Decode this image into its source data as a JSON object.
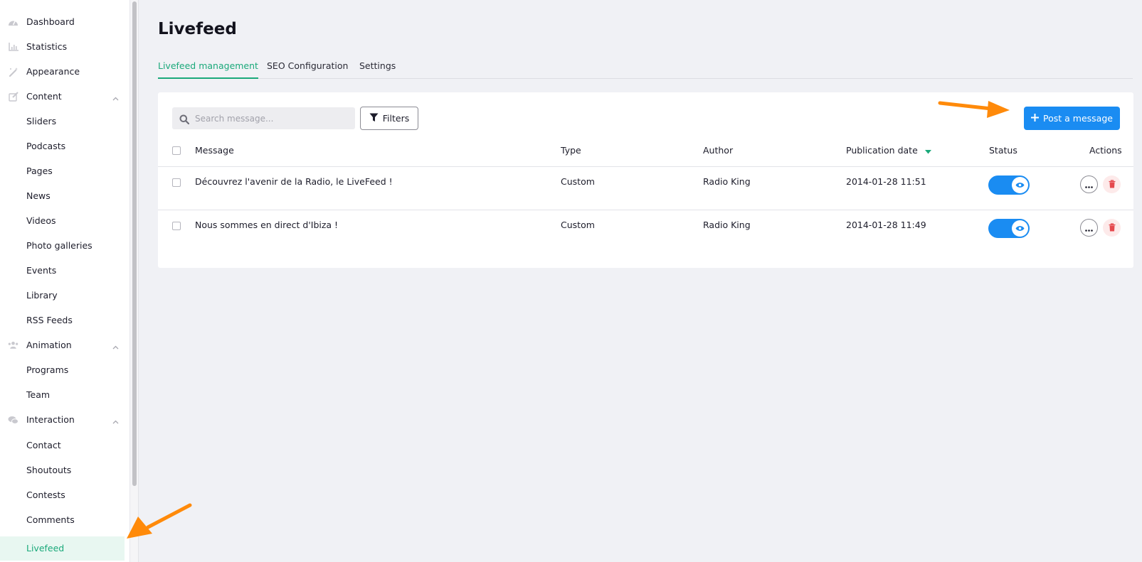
{
  "sidebar": {
    "items": [
      {
        "label": "Dashboard",
        "icon": "dashboard-icon"
      },
      {
        "label": "Statistics",
        "icon": "chart-icon"
      },
      {
        "label": "Appearance",
        "icon": "magic-wand-icon"
      },
      {
        "label": "Content",
        "icon": "edit-icon"
      },
      {
        "label": "Sliders"
      },
      {
        "label": "Podcasts"
      },
      {
        "label": "Pages"
      },
      {
        "label": "News"
      },
      {
        "label": "Videos"
      },
      {
        "label": "Photo galleries"
      },
      {
        "label": "Events"
      },
      {
        "label": "Library"
      },
      {
        "label": "RSS Feeds"
      },
      {
        "label": "Animation",
        "icon": "users-icon"
      },
      {
        "label": "Programs"
      },
      {
        "label": "Team"
      },
      {
        "label": "Interaction",
        "icon": "chat-icon"
      },
      {
        "label": "Contact"
      },
      {
        "label": "Shoutouts"
      },
      {
        "label": "Contests"
      },
      {
        "label": "Comments"
      },
      {
        "label": "Livefeed",
        "active": true
      }
    ]
  },
  "page": {
    "title": "Livefeed",
    "tabs": [
      {
        "label": "Livefeed management",
        "active": true
      },
      {
        "label": "SEO Configuration"
      },
      {
        "label": "Settings"
      }
    ]
  },
  "toolbar": {
    "search_placeholder": "Search message...",
    "filters_label": "Filters",
    "post_label": "Post a message"
  },
  "table": {
    "columns": [
      "Message",
      "Type",
      "Author",
      "Publication date",
      "Status",
      "Actions"
    ],
    "rows": [
      {
        "message": "Découvrez l'avenir de la Radio, le LiveFeed !",
        "type": "Custom",
        "author": "Radio King",
        "date": "2014-01-28 11:51",
        "status_on": true
      },
      {
        "message": "Nous sommes en direct d'Ibiza !",
        "type": "Custom",
        "author": "Radio King",
        "date": "2014-01-28 11:49",
        "status_on": true
      }
    ]
  },
  "colors": {
    "accent_green": "#1aa97a",
    "primary_blue": "#1a8cf2",
    "annotation_orange": "#ff8a0a",
    "delete_red": "#e5484d"
  }
}
